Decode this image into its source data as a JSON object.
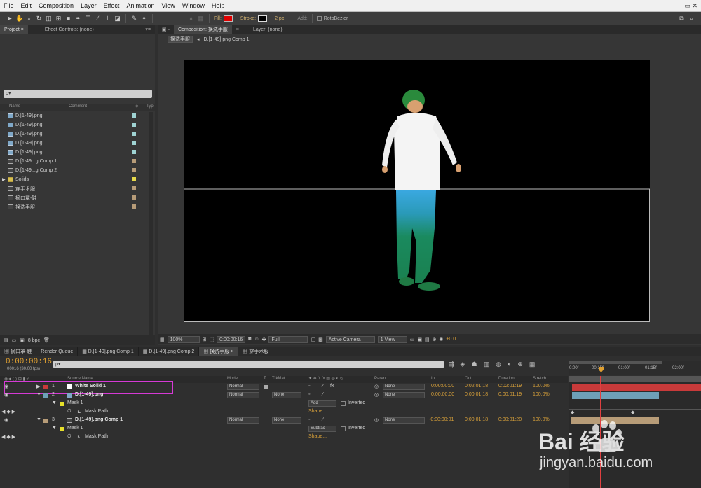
{
  "menu": [
    "File",
    "Edit",
    "Composition",
    "Layer",
    "Effect",
    "Animation",
    "View",
    "Window",
    "Help"
  ],
  "toolbar": {
    "fill_label": "Fill:",
    "stroke_label": "Stroke:",
    "stroke_width": "2 px",
    "add_label": "Add:",
    "rotobezier_label": "RotoBezier",
    "fill_color": "#e00000",
    "stroke_color": "#000000"
  },
  "project": {
    "tabs": [
      "Project ×",
      "Effect Controls: (none)"
    ],
    "search_placeholder": "ρ▾",
    "columns": [
      "Name",
      "Comment",
      "Typ"
    ],
    "items": [
      {
        "name": "D.[1-49].png",
        "type": "footage",
        "label_color": "#9fd3d3"
      },
      {
        "name": "D.[1-49].png",
        "type": "footage",
        "label_color": "#9fd3d3"
      },
      {
        "name": "D.[1-49].png",
        "type": "footage",
        "label_color": "#9fd3d3"
      },
      {
        "name": "D.[1-49].png",
        "type": "footage",
        "label_color": "#9fd3d3"
      },
      {
        "name": "D.[1-49].png",
        "type": "footage",
        "label_color": "#9fd3d3"
      },
      {
        "name": "D.[1-49...g Comp 1",
        "type": "comp",
        "label_color": "#b79c78"
      },
      {
        "name": "D.[1-49...g Comp 2",
        "type": "comp",
        "label_color": "#b79c78"
      },
      {
        "name": "Solids",
        "type": "folder",
        "label_color": "#e6d84a"
      },
      {
        "name": "穿手术服",
        "type": "comp",
        "label_color": "#b79c78"
      },
      {
        "name": "摘口罩-鞋",
        "type": "comp",
        "label_color": "#b79c78"
      },
      {
        "name": "换洗手服",
        "type": "comp",
        "label_color": "#b79c78"
      }
    ],
    "bpc": "8 bpc"
  },
  "viewer": {
    "tabs": [
      "Composition: 换洗手服",
      "Layer: (none)"
    ],
    "breadcrumbs": [
      "换洗手服",
      "D.[1-49].png Comp 1"
    ],
    "zoom": "100%",
    "timecode": "0:00:00:16",
    "resolution": "Full",
    "camera": "Active Camera",
    "view": "1 View",
    "exposure": "+0.0"
  },
  "timeline": {
    "tabs": [
      "摘口罩-鞋",
      "Render Queue",
      "D.[1-49].png Comp 1",
      "D.[1-49].png Comp 2",
      "换洗手服",
      "穿手术服"
    ],
    "active_tab": "换洗手服",
    "timecode": "0:00:00:16",
    "fps": "00016 (30.00 fps)",
    "columns": [
      "Source Name",
      "Mode",
      "T",
      "TrkMat",
      "Parent",
      "In",
      "Out",
      "Duration",
      "Stretch"
    ],
    "ruler": [
      "0:00f",
      "00:15f",
      "01:00f",
      "01:15f",
      "02:00f"
    ],
    "layers": [
      {
        "num": "1",
        "name": "White Solid 1",
        "mode": "Normal",
        "trkmat": "",
        "parent": "None",
        "in": "0:00:00:00",
        "out": "0:02:01:18",
        "duration": "0:02:01:19",
        "stretch": "100.0%",
        "color": "#c83a3a"
      },
      {
        "num": "2",
        "name": "D.[1-49].png",
        "mode": "Normal",
        "trkmat": "None",
        "parent": "None",
        "in": "0:00:00:00",
        "out": "0:00:01:18",
        "duration": "0:00:01:19",
        "stretch": "100.0%",
        "color": "#6ea0b8"
      },
      {
        "num": "3",
        "name": "D.[1-49].png Comp 1",
        "mode": "Normal",
        "trkmat": "None",
        "parent": "None",
        "in": "-0:00:00:01",
        "out": "0:00:01:18",
        "duration": "0:00:01:20",
        "stretch": "100.0%",
        "color": "#b79c78"
      }
    ],
    "masks": [
      {
        "label": "Mask 1",
        "mode": "Add",
        "inverted": "Inverted",
        "path": "Mask Path",
        "shape": "Shape..."
      },
      {
        "label": "Mask 1",
        "mode": "Subtrac",
        "inverted": "Inverted",
        "path": "Mask Path",
        "shape": "Shape..."
      }
    ]
  },
  "watermark": {
    "logo": "Bai 经验",
    "url": "jingyan.baidu.com"
  }
}
